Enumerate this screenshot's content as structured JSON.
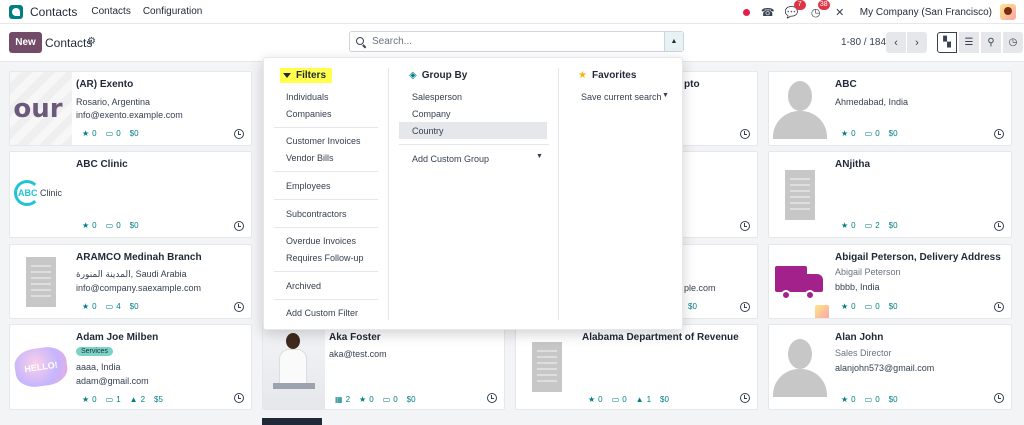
{
  "navbar": {
    "app_name": "Contacts",
    "menus": [
      "Contacts",
      "Configuration"
    ],
    "messages_count": "7",
    "activities_count": "38",
    "company": "My Company (San Francisco)"
  },
  "control_panel": {
    "new_label": "New",
    "breadcrumb": "Contacts",
    "search_placeholder": "Search...",
    "pager": "1-80 / 184"
  },
  "dropdown": {
    "filters": {
      "title": "Filters",
      "items": [
        "Individuals",
        "Companies",
        "Customer Invoices",
        "Vendor Bills",
        "Employees",
        "Subcontractors",
        "Overdue Invoices",
        "Requires Follow-up",
        "Archived",
        "Add Custom Filter"
      ]
    },
    "group_by": {
      "title": "Group By",
      "items": [
        "Salesperson",
        "Company",
        "Country"
      ],
      "add_custom": "Add Custom Group"
    },
    "favorites": {
      "title": "Favorites",
      "save_search": "Save current search"
    }
  },
  "cards": [
    {
      "name": "(AR) Exento",
      "line1": "Rosario, Argentina",
      "line2": "info@exento.example.com",
      "stats": [
        "0",
        "0",
        "$0"
      ]
    },
    {
      "name": "ABC Clinic",
      "logo_text": "Clinic",
      "stats": [
        "0",
        "0",
        "$0"
      ]
    },
    {
      "name": "ARAMCO Medinah Branch",
      "line1": "المدينة المنورة, Saudi Arabia",
      "line2": "info@company.saexample.com",
      "stats": [
        "0",
        "4",
        "$0"
      ]
    },
    {
      "name": "Adam Joe Milben",
      "tag": "Services",
      "line1": "aaaa, India",
      "line2": "adam@gmail.com",
      "stats": [
        "0",
        "1",
        "2",
        "$5"
      ]
    },
    {
      "name": "Aka Foster",
      "line1": "aka@test.com",
      "stats": [
        "2",
        "0",
        "0",
        "$0"
      ]
    },
    {
      "name": "Alabama Department of Revenue",
      "stats": [
        "0",
        "0",
        "1",
        "$0"
      ]
    },
    {
      "name": "ABC",
      "line1": "Ahmedabad, India",
      "stats": [
        "0",
        "0",
        "$0"
      ]
    },
    {
      "name": "ANjitha",
      "stats": [
        "0",
        "2",
        "$0"
      ]
    },
    {
      "name": "Abigail Peterson, Delivery Address",
      "line1": "Abigail Peterson",
      "line2": "bbbb, India",
      "stats": [
        "0",
        "0",
        "$0"
      ]
    },
    {
      "name": "Alan John",
      "line1": "Sales Director",
      "line2": "alanjohn573@gmail.com",
      "stats": [
        "0",
        "0",
        "$0"
      ]
    }
  ],
  "partial": {
    "pto": "pto",
    "ple": "ple.com",
    "s0a": "$0",
    "s0b": "$0"
  },
  "colors": {
    "brand": "#714b67",
    "teal": "#017e84",
    "highlight": "#ffff4c"
  }
}
